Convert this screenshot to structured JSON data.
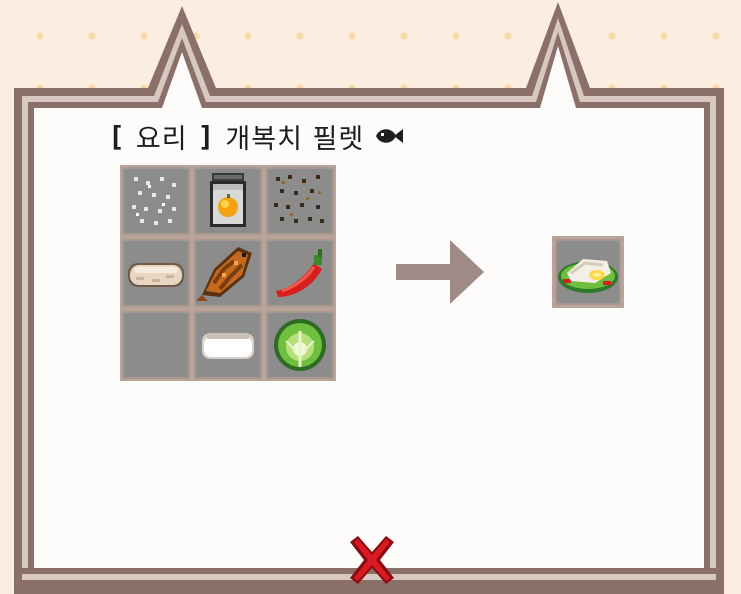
{
  "recipe": {
    "category_open": "[",
    "category": "요리",
    "category_close": "]",
    "dish_name": "개복치 필렛",
    "fish_icon": "fish-icon"
  },
  "ingredients": [
    {
      "icon": "salt-icon"
    },
    {
      "icon": "oil-jar-icon"
    },
    {
      "icon": "pepper-icon"
    },
    {
      "icon": "bread-icon"
    },
    {
      "icon": "grilled-fish-icon"
    },
    {
      "icon": "chili-pepper-icon"
    },
    {
      "icon": "empty-slot"
    },
    {
      "icon": "tofu-icon"
    },
    {
      "icon": "cabbage-icon"
    }
  ],
  "result": {
    "icon": "fish-fillet-dish-icon"
  },
  "close_button": {
    "icon": "close-x-icon"
  },
  "colors": {
    "background": "#fbeee0",
    "frame": "#8a7068",
    "panel": "#fdfcfb",
    "slot": "#8c8c8c",
    "arrow": "#a08a86",
    "close": "#c0121a"
  }
}
